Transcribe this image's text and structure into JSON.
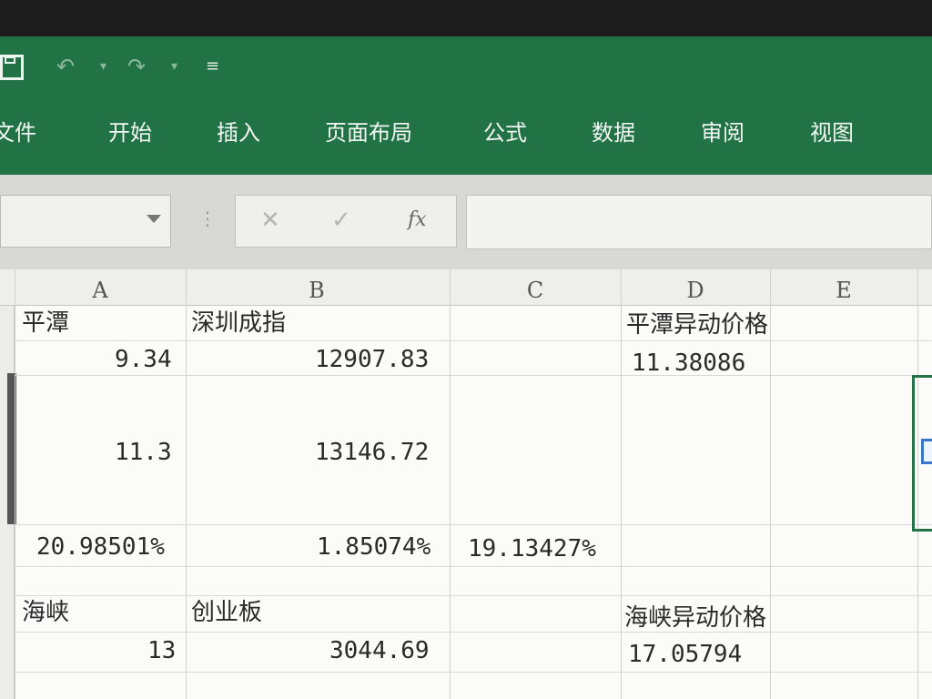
{
  "quick_access": {
    "undo_icon": "↶",
    "redo_icon": "↷",
    "dropdown_icon": "▾",
    "customize_icon": "≡"
  },
  "ribbon": {
    "tabs": [
      {
        "label": "文件"
      },
      {
        "label": "开始"
      },
      {
        "label": "插入"
      },
      {
        "label": "页面布局"
      },
      {
        "label": "公式"
      },
      {
        "label": "数据"
      },
      {
        "label": "审阅"
      },
      {
        "label": "视图"
      }
    ]
  },
  "formula": {
    "cancel_icon": "✕",
    "enter_icon": "✓",
    "fx_label": "fx",
    "value": ""
  },
  "sheet": {
    "columns": [
      "A",
      "B",
      "C",
      "D",
      "E"
    ],
    "cells": {
      "A1": "平潭",
      "B1": "深圳成指",
      "D1": "平潭异动价格",
      "A2": "9.34",
      "B2": "12907.83",
      "D2": "11.38086",
      "A3": "11.3",
      "B3": "13146.72",
      "A4": "20.98501%",
      "B4": "1.85074%",
      "C4": "19.13427%",
      "A6": "海峡",
      "B6": "创业板",
      "D6": "海峡异动价格",
      "A7": "13",
      "B7": "3044.69",
      "D7": "17.05794"
    }
  },
  "colors": {
    "ribbon": "#217346",
    "grid": "#fbfbfa",
    "header": "#eeeeed"
  }
}
